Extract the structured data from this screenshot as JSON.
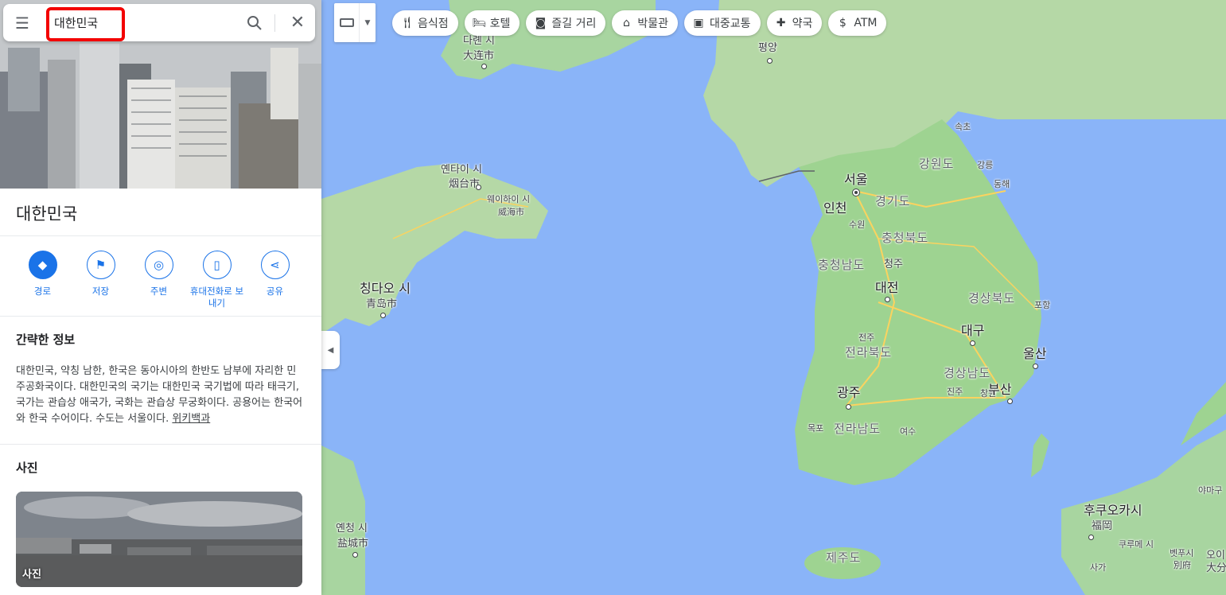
{
  "search": {
    "value": "대한민국"
  },
  "place": {
    "title": "대한민국"
  },
  "actions": [
    {
      "label": "경로"
    },
    {
      "label": "저장"
    },
    {
      "label": "주변"
    },
    {
      "label": "휴대전화로 보내기"
    },
    {
      "label": "공유"
    }
  ],
  "summary": {
    "heading": "간략한 정보",
    "text": "대한민국, 약칭 남한, 한국은 동아시아의 한반도 남부에 자리한 민주공화국이다. 대한민국의 국기는 대한민국 국기법에 따라 태극기, 국가는 관습상 애국가, 국화는 관습상 무궁화이다. 공용어는 한국어와 한국 수어이다. 수도는 서울이다. ",
    "link": "위키백과"
  },
  "photos": {
    "heading": "사진",
    "caption": "사진"
  },
  "chips": [
    {
      "label": "음식점",
      "icon": "fork-knife-icon"
    },
    {
      "label": "호텔",
      "icon": "bed-icon"
    },
    {
      "label": "즐길 거리",
      "icon": "camera-icon"
    },
    {
      "label": "박물관",
      "icon": "museum-icon"
    },
    {
      "label": "대중교통",
      "icon": "transit-icon"
    },
    {
      "label": "약국",
      "icon": "pharmacy-icon"
    },
    {
      "label": "ATM",
      "icon": "atm-icon"
    }
  ],
  "map_labels": {
    "dalian_ko": "다롄 시",
    "dalian_cn": "大连市",
    "pyongyang": "평양",
    "sokcho": "속초",
    "yantai_ko": "옌타이 시",
    "yantai_cn": "烟台市",
    "weihai_ko": "웨이하이 시",
    "weihai_cn": "威海市",
    "seoul": "서울",
    "gangwon": "강원도",
    "gangneung": "강릉",
    "donghae": "동해",
    "incheon": "인천",
    "gyeonggi": "경기도",
    "suwon": "수원",
    "chungbuk": "충청북도",
    "chungnam": "충청남도",
    "cheongju": "청주",
    "qingdao_ko": "칭다오 시",
    "qingdao_cn": "青岛市",
    "daejeon": "대전",
    "gyeongbuk": "경상북도",
    "pohang": "포항",
    "daegu": "대구",
    "jeonju": "전주",
    "jeonbuk": "전라북도",
    "ulsan": "울산",
    "gyeongnam": "경상남도",
    "jinju": "진주",
    "changwon": "창원",
    "busan": "부산",
    "gwangju": "광주",
    "mokpo": "목포",
    "jeonnam": "전라남도",
    "yeosu": "여수",
    "yancheng_ko": "옌청 시",
    "yancheng_cn": "盐城市",
    "jeju": "제주도",
    "fukuoka_ko": "후쿠오카시",
    "fukuoka_jp": "福岡",
    "kurume": "쿠루메 시",
    "beppu_ko": "벳푸시",
    "beppu_jp": "別府",
    "oita_ko": "오이",
    "oita_jp": "大分",
    "saga": "사가",
    "yamaguchi": "야마구"
  }
}
